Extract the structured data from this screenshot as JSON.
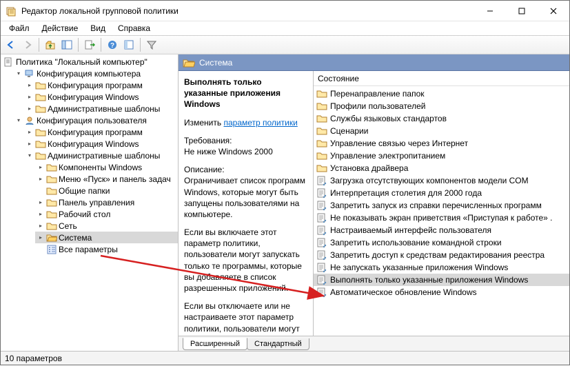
{
  "window": {
    "title": "Редактор локальной групповой политики"
  },
  "menu": {
    "file": "Файл",
    "action": "Действие",
    "view": "Вид",
    "help": "Справка"
  },
  "tree": {
    "root": "Политика \"Локальный компьютер\"",
    "computer_conf": "Конфигурация компьютера",
    "comp_prog": "Конфигурация программ",
    "comp_win": "Конфигурация Windows",
    "comp_admin": "Административные шаблоны",
    "user_conf": "Конфигурация пользователя",
    "user_prog": "Конфигурация программ",
    "user_win": "Конфигурация Windows",
    "user_admin": "Административные шаблоны",
    "comp_windows": "Компоненты Windows",
    "startmenu": "Меню «Пуск» и панель задач",
    "shared_folders": "Общие папки",
    "control_panel": "Панель управления",
    "desktop": "Рабочий стол",
    "network": "Сеть",
    "system": "Система",
    "all_settings": "Все параметры"
  },
  "header": {
    "title": "Система"
  },
  "details": {
    "policy_title": "Выполнять только указанные приложения Windows",
    "edit_prefix": "Изменить ",
    "edit_link": "параметр политики",
    "req_label": "Требования:",
    "req_value": "Не ниже Windows 2000",
    "desc_label": "Описание:",
    "desc_p1": "Ограничивает список программ Windows, которые могут быть запущены пользователями на компьютере.",
    "desc_p2": "Если вы включаете этот параметр политики, пользователи могут запускать только те программы, которые вы добавляете в список разрешенных приложений.",
    "desc_p3": "Если вы отключаете или не настраиваете этот параметр политики, пользователи могут"
  },
  "list": {
    "header": "Состояние",
    "items": [
      {
        "kind": "folder",
        "label": "Перенаправление папок"
      },
      {
        "kind": "folder",
        "label": "Профили пользователей"
      },
      {
        "kind": "folder",
        "label": "Службы языковых стандартов"
      },
      {
        "kind": "folder",
        "label": "Сценарии"
      },
      {
        "kind": "folder",
        "label": "Управление связью через Интернет"
      },
      {
        "kind": "folder",
        "label": "Управление электропитанием"
      },
      {
        "kind": "folder",
        "label": "Установка драйвера"
      },
      {
        "kind": "setting",
        "label": "Загрузка отсутствующих компонентов модели COM"
      },
      {
        "kind": "setting",
        "label": "Интерпретация столетия для 2000 года"
      },
      {
        "kind": "setting",
        "label": "Запретить запуск из справки перечисленных программ"
      },
      {
        "kind": "setting",
        "label": "Не показывать экран приветствия «Приступая к работе» ."
      },
      {
        "kind": "setting",
        "label": "Настраиваемый интерфейс пользователя"
      },
      {
        "kind": "setting",
        "label": "Запретить использование командной строки"
      },
      {
        "kind": "setting",
        "label": "Запретить доступ к средствам редактирования реестра"
      },
      {
        "kind": "setting",
        "label": "Не запускать указанные приложения Windows"
      },
      {
        "kind": "setting",
        "label": "Выполнять только указанные приложения Windows",
        "selected": true
      },
      {
        "kind": "setting",
        "label": "Автоматическое обновление Windows"
      }
    ]
  },
  "tabs": {
    "extended": "Расширенный",
    "standard": "Стандартный"
  },
  "status": {
    "text": "10 параметров"
  }
}
